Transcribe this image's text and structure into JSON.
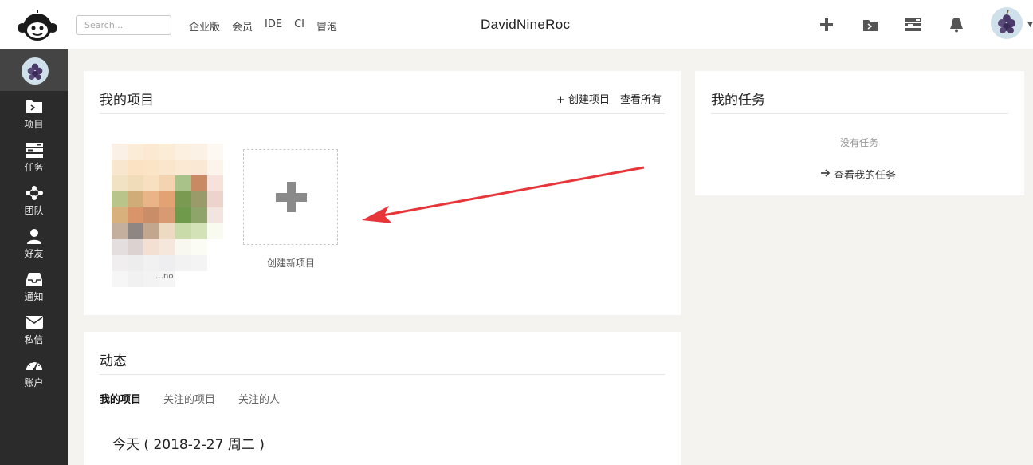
{
  "header": {
    "search_placeholder": "Search...",
    "nav": [
      "企业版",
      "会员",
      "IDE",
      "CI",
      "冒泡"
    ],
    "site_title": "DavidNineRoc"
  },
  "sidebar": {
    "items": [
      {
        "label": "项目",
        "icon": "folder-icon"
      },
      {
        "label": "任务",
        "icon": "tasks-icon"
      },
      {
        "label": "团队",
        "icon": "team-icon"
      },
      {
        "label": "好友",
        "icon": "user-icon"
      },
      {
        "label": "通知",
        "icon": "inbox-icon"
      },
      {
        "label": "私信",
        "icon": "envelope-icon"
      },
      {
        "label": "账户",
        "icon": "dashboard-icon"
      }
    ]
  },
  "projects": {
    "title": "我的项目",
    "create_link": "+ 创建项目",
    "view_all": "查看所有",
    "project_name": "…no",
    "new_project_label": "创建新项目"
  },
  "tasks": {
    "title": "我的任务",
    "empty": "没有任务",
    "view_link": "查看我的任务"
  },
  "activity": {
    "title": "动态",
    "tabs": [
      "我的项目",
      "关注的项目",
      "关注的人"
    ],
    "date_line": "今天 ( 2018-2-27 周二 )"
  },
  "colors": {
    "sidebar_bg": "#2b2b2b",
    "arrow": "#e8353a"
  }
}
